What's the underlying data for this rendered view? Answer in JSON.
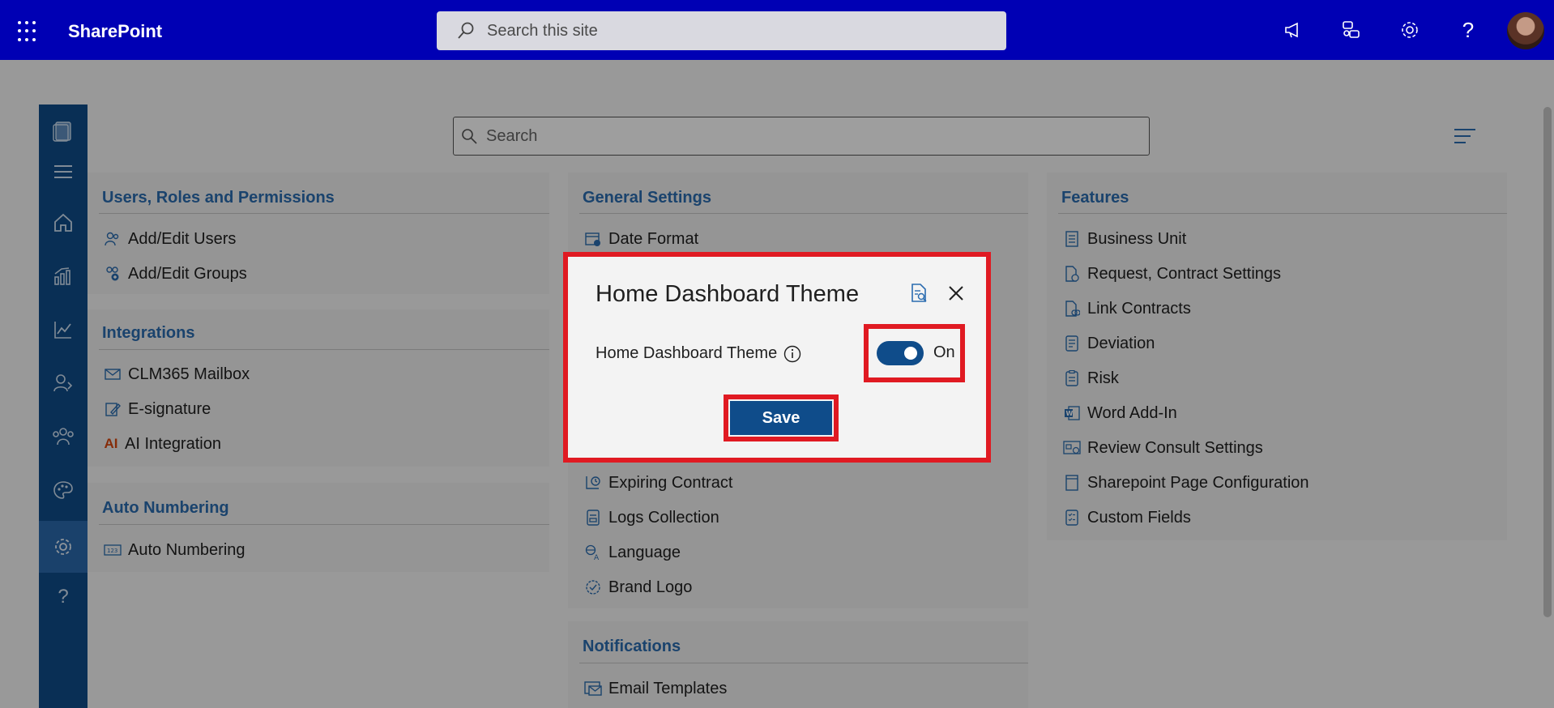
{
  "suitebar": {
    "brand": "SharePoint",
    "search_placeholder": "Search this site",
    "icons": [
      "waffle-icon",
      "announcement-icon",
      "feedback-icon",
      "settings-icon",
      "help-icon",
      "avatar"
    ]
  },
  "app": {
    "search_placeholder": "Search"
  },
  "rail": {
    "items": [
      "documents-icon",
      "hamburger-icon",
      "home-icon",
      "reports-icon",
      "analytics-icon",
      "user-settings-icon",
      "teams-icon",
      "theme-icon",
      "settings-icon",
      "help-icon"
    ],
    "active": "settings-icon"
  },
  "panels": {
    "users": {
      "title": "Users, Roles and Permissions",
      "items": [
        "Add/Edit Users",
        "Add/Edit Groups"
      ]
    },
    "integrations": {
      "title": "Integrations",
      "items": [
        "CLM365 Mailbox",
        "E-signature",
        "AI Integration"
      ]
    },
    "auto_numbering": {
      "title": "Auto Numbering",
      "items": [
        "Auto Numbering"
      ]
    },
    "general": {
      "title": "General Settings",
      "items": [
        "Date Format",
        "Expiring Contract",
        "Logs Collection",
        "Language",
        "Brand Logo"
      ]
    },
    "notifications": {
      "title": "Notifications",
      "items": [
        "Email Templates"
      ]
    },
    "features": {
      "title": "Features",
      "items": [
        "Business Unit",
        "Request, Contract Settings",
        "Link Contracts",
        "Deviation",
        "Risk",
        "Word Add-In",
        "Review Consult Settings",
        "Sharepoint Page Configuration",
        "Custom Fields"
      ]
    }
  },
  "dialog": {
    "title": "Home Dashboard Theme",
    "setting_label": "Home Dashboard Theme",
    "toggle_state": "On",
    "save_label": "Save"
  },
  "colors": {
    "suitebar": "#0000b4",
    "rail": "#0f4c8a",
    "accent_text": "#2b6cb0",
    "highlight": "#e01a22"
  }
}
